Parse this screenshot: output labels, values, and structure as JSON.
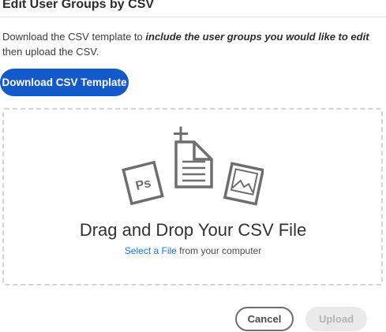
{
  "dialog": {
    "title": "Edit User Groups by CSV",
    "description_pre": "Download the CSV template to ",
    "description_emphasis": "include the user groups you would like to edit",
    "description_post": " then upload the CSV.",
    "download_label": "Download CSV Template"
  },
  "dropzone": {
    "heading": "Drag and Drop Your CSV File",
    "select_link": "Select a File",
    "select_rest": " from your computer",
    "icons": [
      "photoshop-file-icon",
      "add-document-icon",
      "image-file-icon"
    ],
    "ps_label": "Ps"
  },
  "footer": {
    "cancel_label": "Cancel",
    "upload_label": "Upload",
    "upload_enabled": false
  },
  "colors": {
    "accent": "#1359c9",
    "link": "#1473e6",
    "disabled_bg": "#eaeaea",
    "disabled_text": "#b3b3b3",
    "dropzone_border": "#d3d3d3",
    "icon_gray": "#6e6e6e"
  }
}
